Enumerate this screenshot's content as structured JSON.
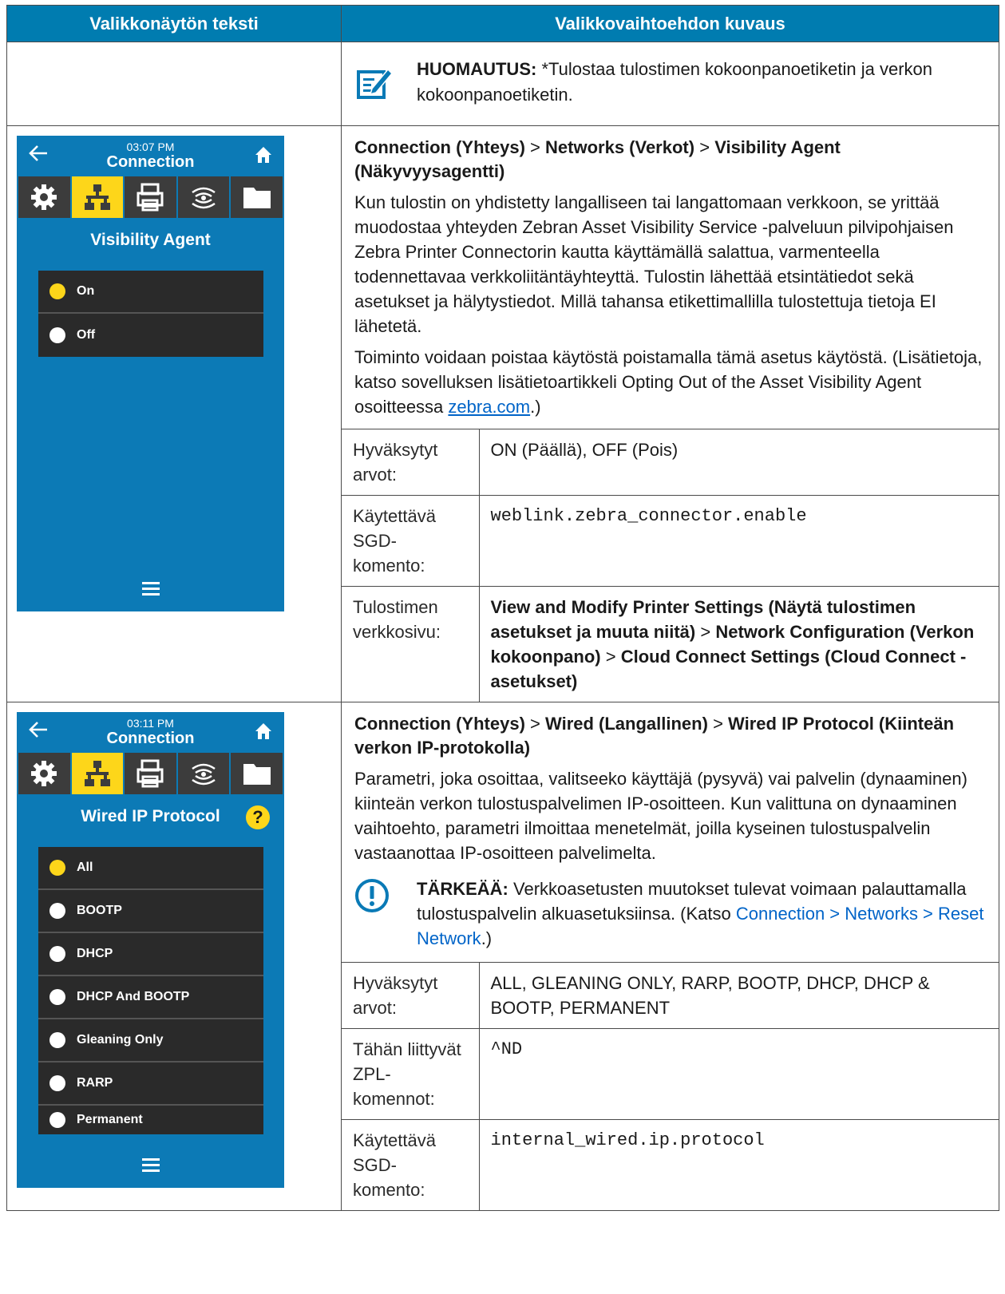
{
  "header": {
    "col1": "Valikkonäytön teksti",
    "col2": "Valikkovaihtoehdon kuvaus"
  },
  "note": {
    "label": "HUOMAUTUS:",
    "text": " *Tulostaa tulostimen kokoonpanoetiketin ja verkon kokoonpanoetiketin.",
    "icon": "note-edit-icon"
  },
  "visibility": {
    "screen": {
      "time": "03:07 PM",
      "title": "Connection",
      "menu_title": "Visibility Agent",
      "options": [
        "On",
        "Off"
      ],
      "selected": "On"
    },
    "path": [
      "Connection (Yhteys)",
      "Networks (Verkot)",
      "Visibility Agent (Näkyvyysagentti)"
    ],
    "separator": ">",
    "desc1": "Kun tulostin on yhdistetty langalliseen tai langattomaan verkkoon, se yrittää muodostaa yhteyden Zebran Asset Visibility Service -palveluun pilvipohjaisen Zebra Printer Connectorin kautta käyttämällä salattua, varmenteella todennettavaa verkkoliitäntäyhteyttä. Tulostin lähettää etsintätiedot sekä asetukset ja hälytystiedot. Millä tahansa etikettimallilla tulostettuja tietoja EI lähetetä.",
    "desc2_pre": "Toiminto voidaan poistaa käytöstä poistamalla tämä asetus käytöstä. (Lisätietoja, katso sovelluksen lisätietoartikkeli Opting Out of the Asset Visibility Agent osoitteessa ",
    "desc2_link": "zebra.com",
    "desc2_post": ".)",
    "rows": [
      {
        "key": "Hyväksytyt arvot:",
        "value": "ON (Päällä), OFF (Pois)"
      },
      {
        "key": "Käytettävä SGD-komento:",
        "value": "weblink.zebra_connector.enable"
      },
      {
        "key": "Tulostimen verkkosivu:",
        "value_parts": [
          "View and Modify Printer Settings (Näytä tulostimen asetukset ja muuta niitä)",
          "Network Configuration (Verkon kokoonpano)",
          "Cloud Connect Settings (Cloud Connect -asetukset)"
        ]
      }
    ]
  },
  "wired": {
    "screen": {
      "time": "03:11 PM",
      "title": "Connection",
      "menu_title": "Wired IP Protocol",
      "help": "?",
      "options": [
        "All",
        "BOOTP",
        "DHCP",
        "DHCP And BOOTP",
        "Gleaning Only",
        "RARP",
        "Permanent"
      ],
      "selected": "All"
    },
    "path": [
      "Connection (Yhteys)",
      "Wired (Langallinen)",
      "Wired IP Protocol (Kiinteän verkon IP-protokolla)"
    ],
    "desc": "Parametri, joka osoittaa, valitseeko käyttäjä (pysyvä) vai palvelin (dynaaminen) kiinteän verkon tulostuspalvelimen IP-osoitteen. Kun valittuna on dynaaminen vaihtoehto, parametri ilmoittaa menetelmät, joilla kyseinen tulostuspalvelin vastaanottaa IP-osoitteen palvelimelta.",
    "important": {
      "label": "TÄRKEÄÄ:",
      "text": " Verkkoasetusten muutokset tulevat voimaan palauttamalla tulostuspalvelin alkuasetuksiinsa. (Katso ",
      "link": "Connection > Networks > Reset Network",
      "post": ".)"
    },
    "rows": [
      {
        "key": "Hyväksytyt arvot:",
        "value": "ALL, GLEANING ONLY, RARP, BOOTP, DHCP, DHCP & BOOTP, PERMANENT"
      },
      {
        "key": "Tähän liittyvät ZPL-komennot:",
        "value": "^ND"
      },
      {
        "key": "Käytettävä SGD-komento:",
        "value": "internal_wired.ip.protocol"
      }
    ]
  },
  "colors": {
    "header_bg": "#007cb0",
    "screen_bg": "#0c7ab6",
    "accent_yellow": "#fdd61a",
    "link": "#0064c8"
  }
}
